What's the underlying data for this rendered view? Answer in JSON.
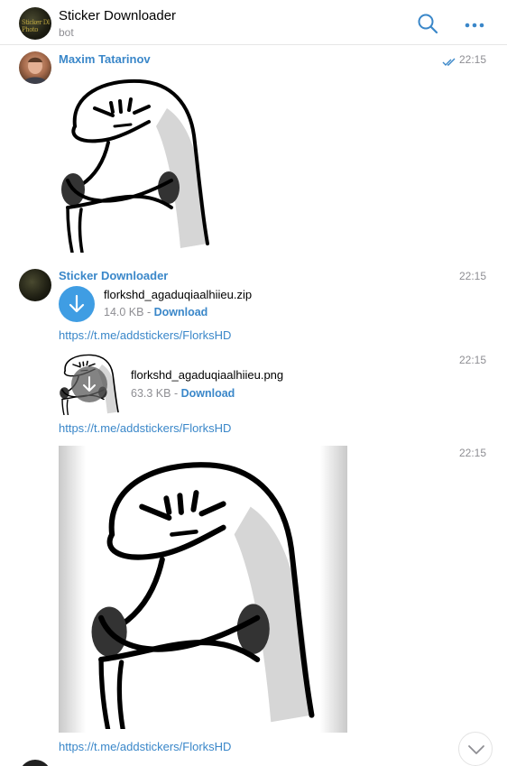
{
  "header": {
    "title": "Sticker Downloader",
    "subtitle": "bot",
    "avatar_text": "Sticker Dl Photo",
    "search_icon": "search-icon",
    "more_icon": "more-dots-icon",
    "accent_color": "#3a87c9"
  },
  "messages": [
    {
      "sender": "Maxim Tatarinov",
      "time": "22:15",
      "status_icon": "double-check-icon",
      "content": "sticker"
    },
    {
      "sender": "Sticker Downloader",
      "time": "22:15",
      "file": {
        "name": "florkshd_agaduqiaalhiieu.zip",
        "size": "14.0 KB",
        "separator": " - ",
        "action": "Download",
        "icon": "download-arrow-icon"
      },
      "link": "https://t.me/addstickers/FlorksHD"
    },
    {
      "time": "22:15",
      "file": {
        "name": "florkshd_agaduqiaalhiieu.png",
        "size": "63.3 KB",
        "separator": " - ",
        "action": "Download",
        "icon": "download-arrow-icon"
      },
      "link": "https://t.me/addstickers/FlorksHD"
    },
    {
      "time": "22:15",
      "content": "image",
      "link": "https://t.me/addstickers/FlorksHD"
    }
  ],
  "scroll_button_icon": "chevron-down-icon"
}
